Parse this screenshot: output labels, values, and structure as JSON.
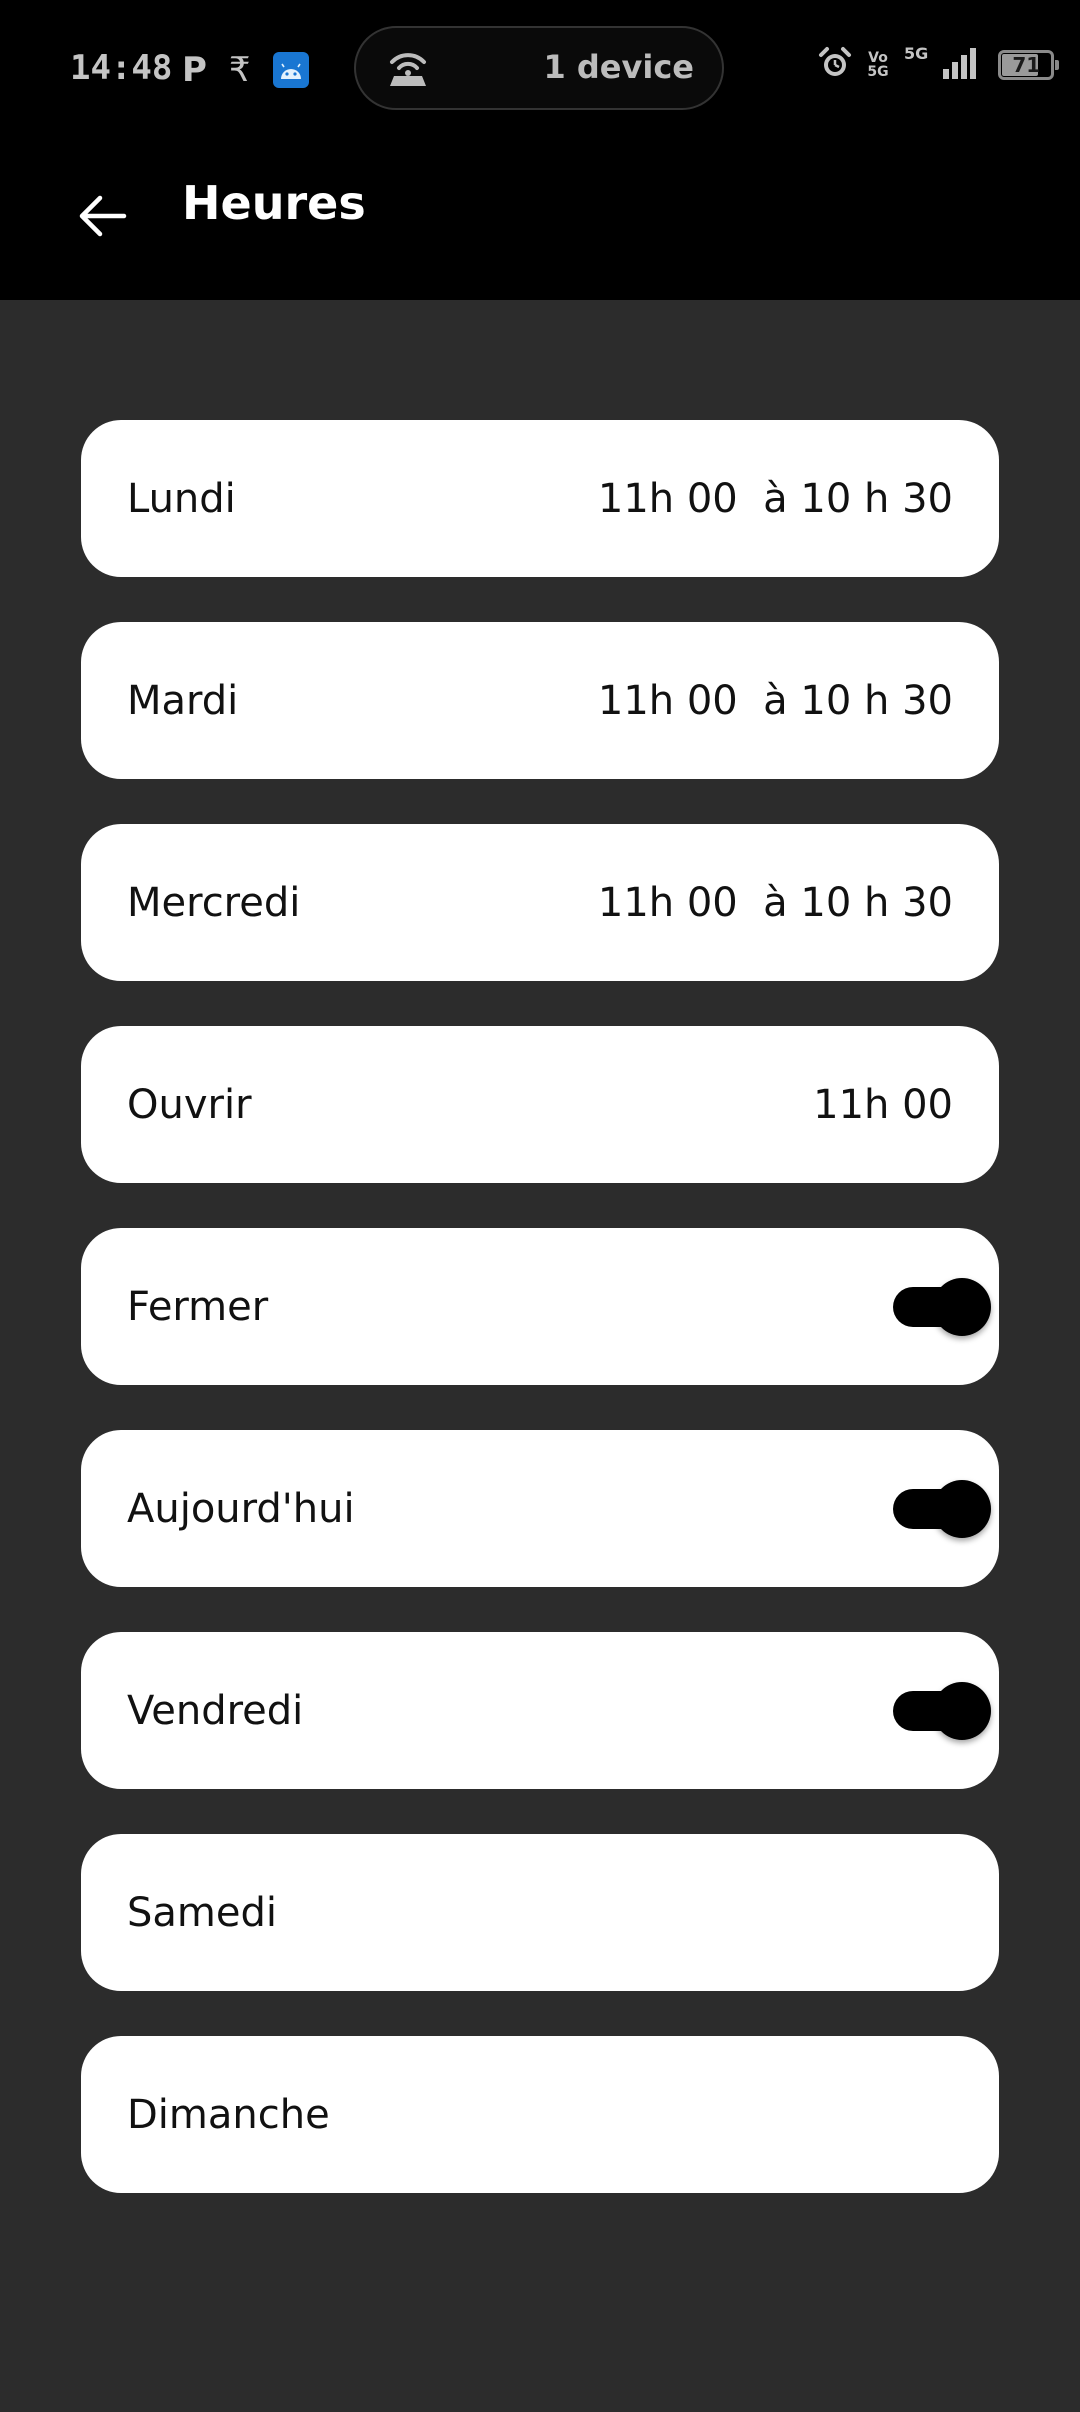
{
  "status_bar": {
    "time": "14:48",
    "notif_p": "P",
    "notif_rupee": "₹",
    "android_icon": "android-icon",
    "hotspot_text": "1 device",
    "volte_top": "Vo",
    "volte_bottom": "5G",
    "network_type": "5G",
    "battery_level": "71"
  },
  "app_bar": {
    "title": "Heures",
    "back_icon": "arrow-left-icon"
  },
  "rows": [
    {
      "label": "Lundi",
      "value": "11h 00  à 10 h 30"
    },
    {
      "label": "Mardi",
      "value": "11h 00  à 10 h 30"
    },
    {
      "label": "Mercredi",
      "value": "11h 00  à 10 h 30"
    },
    {
      "label": "Ouvrir",
      "value": "11h 00"
    },
    {
      "label": "Fermer",
      "toggle": true
    },
    {
      "label": "Aujourd'hui",
      "toggle": true
    },
    {
      "label": "Vendredi",
      "toggle": true
    },
    {
      "label": "Samedi"
    },
    {
      "label": "Dimanche"
    }
  ],
  "colors": {
    "background": "#2c2c2c",
    "bar": "#000000",
    "card": "#ffffff",
    "toggle": "#000000"
  }
}
